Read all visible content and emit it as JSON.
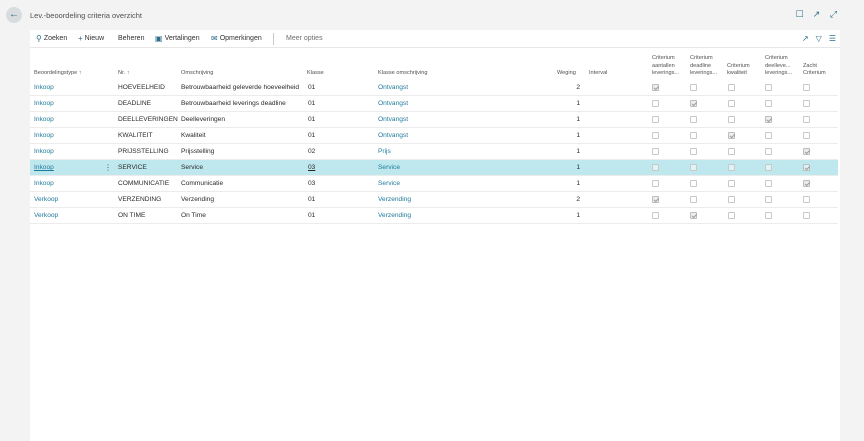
{
  "header": {
    "title": "Lev.-beoordeling criteria overzicht"
  },
  "actions": {
    "search": "Zoeken",
    "new": "Nieuw",
    "manage": "Beheren",
    "translations": "Vertalingen",
    "remarks": "Opmerkingen",
    "more": "Meer opties"
  },
  "columns": {
    "type": "Beoordelingstype ↑",
    "nr": "Nr. ↑",
    "description": "Omschrijving",
    "class": "Klasse",
    "class_description": "Klasse omschrijving",
    "weight": "Weging",
    "interval": "Interval",
    "crit_count": [
      "Criterium",
      "aantallen",
      "leverings..."
    ],
    "crit_deadline": [
      "Criterium",
      "deadline",
      "leverings..."
    ],
    "crit_quality": [
      "Criterium",
      "kwaliteit"
    ],
    "crit_partial": [
      "Criterium",
      "deelleve...",
      "leverings..."
    ],
    "soft": [
      "Zacht",
      "Criterium"
    ]
  },
  "rows": [
    {
      "type": "Inkoop",
      "nr": "HOEVEELHEID",
      "description": "Betrouwbaarheid geleverde hoeveelheid",
      "class": "01",
      "class_description": "Ontvangst",
      "weight": "2",
      "interval": "",
      "checks": [
        true,
        false,
        false,
        false,
        false
      ]
    },
    {
      "type": "Inkoop",
      "nr": "DEADLINE",
      "description": "Betrouwbaarheid leverings deadline",
      "class": "01",
      "class_description": "Ontvangst",
      "weight": "1",
      "interval": "",
      "checks": [
        false,
        true,
        false,
        false,
        false
      ]
    },
    {
      "type": "Inkoop",
      "nr": "DEELLEVERINGEN",
      "description": "Deelleveringen",
      "class": "01",
      "class_description": "Ontvangst",
      "weight": "1",
      "interval": "",
      "checks": [
        false,
        false,
        false,
        true,
        false
      ]
    },
    {
      "type": "Inkoop",
      "nr": "KWALITEIT",
      "description": "Kwaliteit",
      "class": "01",
      "class_description": "Ontvangst",
      "weight": "1",
      "interval": "",
      "checks": [
        false,
        false,
        true,
        false,
        false
      ]
    },
    {
      "type": "Inkoop",
      "nr": "PRIJSSTELLING",
      "description": "Prijsstelling",
      "class": "02",
      "class_description": "Prijs",
      "weight": "1",
      "interval": "",
      "checks": [
        false,
        false,
        false,
        false,
        true
      ]
    },
    {
      "type": "Inkoop",
      "nr": "SERVICE",
      "description": "Service",
      "class": "03",
      "class_description": "Service",
      "weight": "1",
      "interval": "",
      "checks": [
        false,
        false,
        false,
        false,
        true
      ],
      "selected": true
    },
    {
      "type": "Inkoop",
      "nr": "COMMUNICATIE",
      "description": "Communicatie",
      "class": "03",
      "class_description": "Service",
      "weight": "1",
      "interval": "",
      "checks": [
        false,
        false,
        false,
        false,
        true
      ]
    },
    {
      "type": "Verkoop",
      "nr": "VERZENDING",
      "description": "Verzending",
      "class": "01",
      "class_description": "Verzending",
      "weight": "2",
      "interval": "",
      "checks": [
        true,
        false,
        false,
        false,
        false
      ]
    },
    {
      "type": "Verkoop",
      "nr": "ON TIME",
      "description": "On Time",
      "class": "01",
      "class_description": "Verzending",
      "weight": "1",
      "interval": "",
      "checks": [
        false,
        true,
        false,
        false,
        false
      ]
    }
  ],
  "colors": {
    "accent": "#1f7a9a",
    "selected_row": "#bfe8ee",
    "background": "#f3f3f3"
  }
}
